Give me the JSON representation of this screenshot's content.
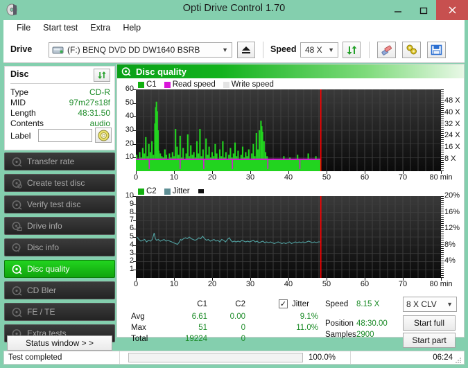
{
  "window": {
    "title": "Opti Drive Control 1.70",
    "icon": "disc-icon",
    "minimize": "—",
    "maximize": "❐",
    "close": "✕"
  },
  "menu": {
    "items": [
      "File",
      "Start test",
      "Extra",
      "Help"
    ]
  },
  "toolbar": {
    "drive_label": "Drive",
    "drive_value": "(F:)   BENQ DVD DD DW1640 BSRB",
    "eject_icon": "eject-icon",
    "speed_label": "Speed",
    "speed_value": "48 X",
    "refresh_icon": "refresh-icon",
    "eraser_icon": "eraser-icon",
    "settings_icon": "settings-icon",
    "save_icon": "save-icon"
  },
  "disc_panel": {
    "title": "Disc",
    "refresh_icon": "refresh-icon",
    "rows": [
      {
        "key": "Type",
        "value": "CD-R"
      },
      {
        "key": "MID",
        "value": "97m27s18f"
      },
      {
        "key": "Length",
        "value": "48:31.50"
      },
      {
        "key": "Contents",
        "value": "audio"
      }
    ],
    "label_key": "Label",
    "label_value": "",
    "label_placeholder": "",
    "label_button_icon": "cd-icon"
  },
  "nav": {
    "items": [
      {
        "label": "Transfer rate",
        "icon": "disc-test-icon",
        "active": false
      },
      {
        "label": "Create test disc",
        "icon": "disc-burn-icon",
        "active": false
      },
      {
        "label": "Verify test disc",
        "icon": "disc-verify-icon",
        "active": false
      },
      {
        "label": "Drive info",
        "icon": "drive-info-icon",
        "active": false
      },
      {
        "label": "Disc info",
        "icon": "disc-info-icon",
        "active": false
      },
      {
        "label": "Disc quality",
        "icon": "disc-quality-icon",
        "active": true
      },
      {
        "label": "CD Bler",
        "icon": "disc-bler-icon",
        "active": false
      },
      {
        "label": "FE / TE",
        "icon": "disc-fete-icon",
        "active": false
      },
      {
        "label": "Extra tests",
        "icon": "disc-extra-icon",
        "active": false
      }
    ],
    "status_window_button": "Status window > >"
  },
  "main": {
    "header_title": "Disc quality",
    "header_icon": "disc-quality-icon"
  },
  "stats": {
    "col_headers": [
      "C1",
      "C2"
    ],
    "jitter_label": "Jitter",
    "jitter_checked": true,
    "rows": [
      {
        "name": "Avg",
        "c1": "6.61",
        "c2": "0.00",
        "jitter": "9.1%"
      },
      {
        "name": "Max",
        "c1": "51",
        "c2": "0",
        "jitter": "11.0%"
      },
      {
        "name": "Total",
        "c1": "19224",
        "c2": "0",
        "jitter": ""
      }
    ],
    "speed_label": "Speed",
    "speed_value": "8.15 X",
    "position_label": "Position",
    "position_value": "48:30.00",
    "samples_label": "Samples",
    "samples_value": "2900",
    "write_mode": "8 X CLV",
    "start_full": "Start full",
    "start_part": "Start part"
  },
  "statusbar": {
    "message": "Test completed",
    "progress_percent": 100.0,
    "progress_text": "100.0%",
    "elapsed": "06:24"
  },
  "colors": {
    "accent": "#84cfae",
    "c1_green": "#22d41f",
    "read_speed": "#d916d9",
    "write_speed": "#e8e8e8",
    "c2_green": "#1b8b27",
    "jitter": "#4f9a9a",
    "position_marker": "#ff0000",
    "value_text": "#1b8b27",
    "close_button": "#c7504f"
  },
  "chart_data": [
    {
      "id": "c1-chart",
      "type": "line",
      "title": "",
      "xlabel": "min",
      "ylabel": "C1",
      "xlim": [
        0,
        80
      ],
      "ylim": [
        0,
        60
      ],
      "xticks": [
        0,
        10,
        20,
        30,
        40,
        50,
        60,
        70,
        80
      ],
      "xtick_labels": [
        "0",
        "10",
        "20",
        "30",
        "40",
        "50",
        "60",
        "70",
        "80 min"
      ],
      "yticks": [
        10,
        20,
        30,
        40,
        50,
        60
      ],
      "ytick_labels": [
        "10",
        "20",
        "30",
        "40",
        "50",
        "60"
      ],
      "y2lim": [
        0,
        56
      ],
      "y2ticks": [
        8,
        16,
        24,
        32,
        40,
        48
      ],
      "y2tick_labels": [
        "8 X",
        "16 X",
        "24 X",
        "32 X",
        "40 X",
        "48 X"
      ],
      "grid": true,
      "legend_position": "top-left",
      "legend": [
        {
          "name": "C1",
          "color": "#12b010"
        },
        {
          "name": "Read speed",
          "color": "#d916d9"
        },
        {
          "name": "Write speed",
          "color": "#e8e8e8"
        }
      ],
      "position_marker_x": 48.5,
      "data_end_x": 48.5,
      "series": [
        {
          "name": "C1",
          "color": "#22d41f",
          "x": [
            0.2,
            0.6,
            1.0,
            1.4,
            1.8,
            2.2,
            2.6,
            3.0,
            3.4,
            3.8,
            4.2,
            4.6,
            5.0,
            5.2,
            5.4,
            5.6,
            5.8,
            6.0,
            6.4,
            6.8,
            7.2,
            7.6,
            8.0,
            8.4,
            8.8,
            9.2,
            9.6,
            10.0,
            10.4,
            10.8,
            11.2,
            11.6,
            12.0,
            12.4,
            12.8,
            13.2,
            13.6,
            14.0,
            14.4,
            14.8,
            15.2,
            15.6,
            16.0,
            16.4,
            16.8,
            17.2,
            17.6,
            18.0,
            18.4,
            18.8,
            19.2,
            19.6,
            20.0,
            20.4,
            20.8,
            21.2,
            21.6,
            22.0,
            22.4,
            22.8,
            23.2,
            23.6,
            24.0,
            24.4,
            24.8,
            25.2,
            25.6,
            26.0,
            26.4,
            26.8,
            27.2,
            27.6,
            28.0,
            28.4,
            28.8,
            29.2,
            29.6,
            30.0,
            30.4,
            30.8,
            31.2,
            31.6,
            32.0,
            32.4,
            32.8,
            33.0,
            33.2,
            33.6,
            34.0,
            34.4,
            34.8,
            35.2,
            35.6,
            36.0,
            36.4,
            36.8,
            37.2,
            37.6,
            38.0,
            38.4,
            38.8,
            39.2,
            39.6,
            40.0,
            40.4,
            40.8,
            41.2,
            41.6,
            42.0,
            42.4,
            42.8,
            43.2,
            43.6,
            44.0,
            44.4,
            44.8,
            45.2,
            45.6,
            46.0,
            46.4,
            46.8,
            47.2,
            47.6,
            48.0,
            48.4
          ],
          "y": [
            12,
            9,
            14,
            10,
            17,
            13,
            25,
            11,
            20,
            14,
            22,
            12,
            35,
            47,
            51,
            44,
            30,
            15,
            13,
            11,
            10,
            16,
            12,
            9,
            13,
            10,
            14,
            11,
            31,
            18,
            12,
            26,
            10,
            17,
            9,
            13,
            27,
            11,
            19,
            12,
            14,
            10,
            22,
            13,
            31,
            11,
            16,
            9,
            24,
            12,
            18,
            10,
            14,
            11,
            20,
            13,
            9,
            16,
            11,
            22,
            10,
            14,
            9,
            12,
            17,
            10,
            13,
            21,
            11,
            15,
            9,
            12,
            18,
            10,
            14,
            11,
            16,
            9,
            13,
            20,
            11,
            28,
            16,
            30,
            37,
            33,
            29,
            22,
            14,
            11,
            9,
            8,
            6,
            5,
            7,
            6,
            9,
            5,
            7,
            6,
            11,
            8,
            5,
            7,
            10,
            6,
            4,
            8,
            5,
            12,
            7,
            6,
            9,
            5,
            8,
            6,
            13,
            7,
            5,
            9,
            6,
            11,
            8
          ]
        },
        {
          "name": "Read speed",
          "color": "#d916d9",
          "x": [
            0,
            48.5
          ],
          "y_x_scale": [
            8.15,
            8.15
          ]
        }
      ]
    },
    {
      "id": "c2-jitter-chart",
      "type": "line",
      "title": "",
      "xlabel": "min",
      "ylabel": "C2",
      "xlim": [
        0,
        80
      ],
      "ylim": [
        0,
        10
      ],
      "xticks": [
        0,
        10,
        20,
        30,
        40,
        50,
        60,
        70,
        80
      ],
      "xtick_labels": [
        "0",
        "10",
        "20",
        "30",
        "40",
        "50",
        "60",
        "70",
        "80 min"
      ],
      "yticks": [
        1,
        2,
        3,
        4,
        5,
        6,
        7,
        8,
        9,
        10
      ],
      "ytick_labels": [
        "1",
        "2",
        "3",
        "4",
        "5",
        "6",
        "7",
        "8",
        "9",
        "10"
      ],
      "y2lim": [
        0,
        20
      ],
      "y2ticks": [
        4,
        8,
        12,
        16,
        20
      ],
      "y2tick_labels": [
        "4%",
        "8%",
        "12%",
        "16%",
        "20%"
      ],
      "grid": true,
      "legend_position": "top-left",
      "legend": [
        {
          "name": "C2",
          "color": "#12b010"
        },
        {
          "name": "Jitter",
          "color": "#4f9a9a"
        }
      ],
      "position_marker_x": 48.5,
      "data_end_x": 48.5,
      "series": [
        {
          "name": "C2",
          "color": "#12b010",
          "x": [],
          "y": []
        },
        {
          "name": "Jitter",
          "color": "#4f9a9a",
          "x": [
            0.3,
            0.8,
            1.3,
            1.8,
            2.3,
            2.8,
            3.3,
            3.8,
            4.3,
            4.8,
            5.1,
            5.4,
            5.9,
            6.4,
            6.9,
            7.4,
            7.9,
            8.4,
            8.9,
            9.4,
            9.9,
            10.4,
            10.9,
            11.4,
            11.7,
            12.0,
            12.5,
            13.0,
            13.5,
            14.0,
            14.5,
            15.0,
            15.5,
            16.0,
            16.5,
            17.0,
            17.5,
            18.0,
            18.5,
            19.0,
            19.5,
            20.0,
            20.5,
            21.0,
            21.5,
            22.0,
            22.5,
            23.0,
            23.5,
            24.0,
            24.5,
            24.9,
            25.3,
            25.8,
            26.3,
            26.8,
            27.3,
            27.8,
            28.3,
            28.8,
            29.3,
            29.8,
            30.3,
            30.8,
            31.3,
            31.8,
            32.3,
            32.8,
            33.3,
            33.8,
            34.3,
            34.8,
            35.3,
            35.8,
            36.3,
            36.8,
            37.3,
            37.8,
            38.3,
            38.8,
            39.3,
            39.8,
            40.3,
            40.8,
            41.3,
            41.8,
            42.3,
            42.8,
            43.3,
            43.8,
            44.3,
            44.8,
            45.3,
            45.8,
            46.3,
            46.8,
            47.3,
            47.8,
            48.3
          ],
          "y_percent": [
            10.0,
            9.4,
            9.0,
            9.2,
            9.4,
            8.8,
            9.2,
            9.0,
            9.4,
            11.0,
            9.6,
            9.2,
            9.4,
            9.0,
            9.2,
            9.4,
            9.0,
            9.2,
            9.0,
            8.8,
            8.6,
            8.4,
            8.2,
            8.8,
            9.4,
            9.2,
            9.6,
            9.8,
            9.6,
            10.0,
            9.6,
            9.4,
            9.2,
            9.4,
            9.8,
            9.6,
            10.2,
            9.6,
            9.2,
            9.4,
            9.0,
            9.2,
            9.4,
            9.0,
            9.2,
            8.8,
            9.4,
            9.2,
            8.8,
            9.4,
            9.8,
            9.2,
            8.8,
            9.0,
            8.8,
            9.0,
            8.8,
            9.2,
            9.0,
            8.8,
            9.0,
            8.8,
            9.0,
            9.2,
            8.8,
            9.0,
            8.6,
            8.8,
            9.0,
            8.6,
            8.8,
            8.6,
            8.8,
            8.6,
            8.4,
            8.6,
            8.8,
            8.6,
            8.4,
            8.6,
            8.4,
            8.6,
            8.8,
            8.4,
            8.6,
            8.8,
            8.6,
            8.8,
            8.6,
            8.8,
            8.6,
            8.8,
            9.0,
            8.8,
            8.6,
            8.8,
            8.6,
            8.8,
            8.8
          ]
        }
      ]
    }
  ]
}
